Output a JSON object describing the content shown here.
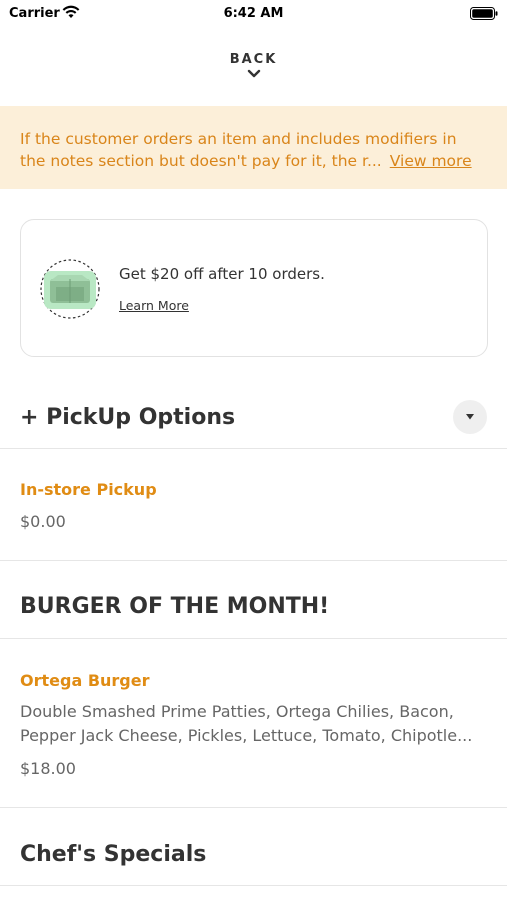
{
  "status_bar": {
    "carrier": "Carrier",
    "time": "6:42 AM"
  },
  "nav": {
    "back_label": "BACK"
  },
  "notice": {
    "line1": "If the customer orders an item and includes modifiers in",
    "line2": "the notes section but doesn't pay for it, the r...",
    "view_more": "View more",
    "color": "#d9851a",
    "background": "#fcefd9"
  },
  "reward": {
    "title": "Get $20 off after 10 orders.",
    "link": "Learn More",
    "icon": "rewards-box-icon"
  },
  "pickup": {
    "header": "+ PickUp Options",
    "dropdown_icon": "caret-down-icon",
    "item_name": "In-store Pickup",
    "item_price": "$0.00"
  },
  "burger_of_month": {
    "header": "BURGER OF THE MONTH!",
    "item_name": "Ortega Burger",
    "desc_line1": "Double Smashed Prime Patties, Ortega Chilies, Bacon,",
    "desc_line2": "Pepper Jack Cheese, Pickles, Lettuce, Tomato, Chipotle...",
    "item_price": "$18.00"
  },
  "chefs_specials": {
    "header": "Chef's Specials"
  },
  "accent_color": "#e08c14"
}
